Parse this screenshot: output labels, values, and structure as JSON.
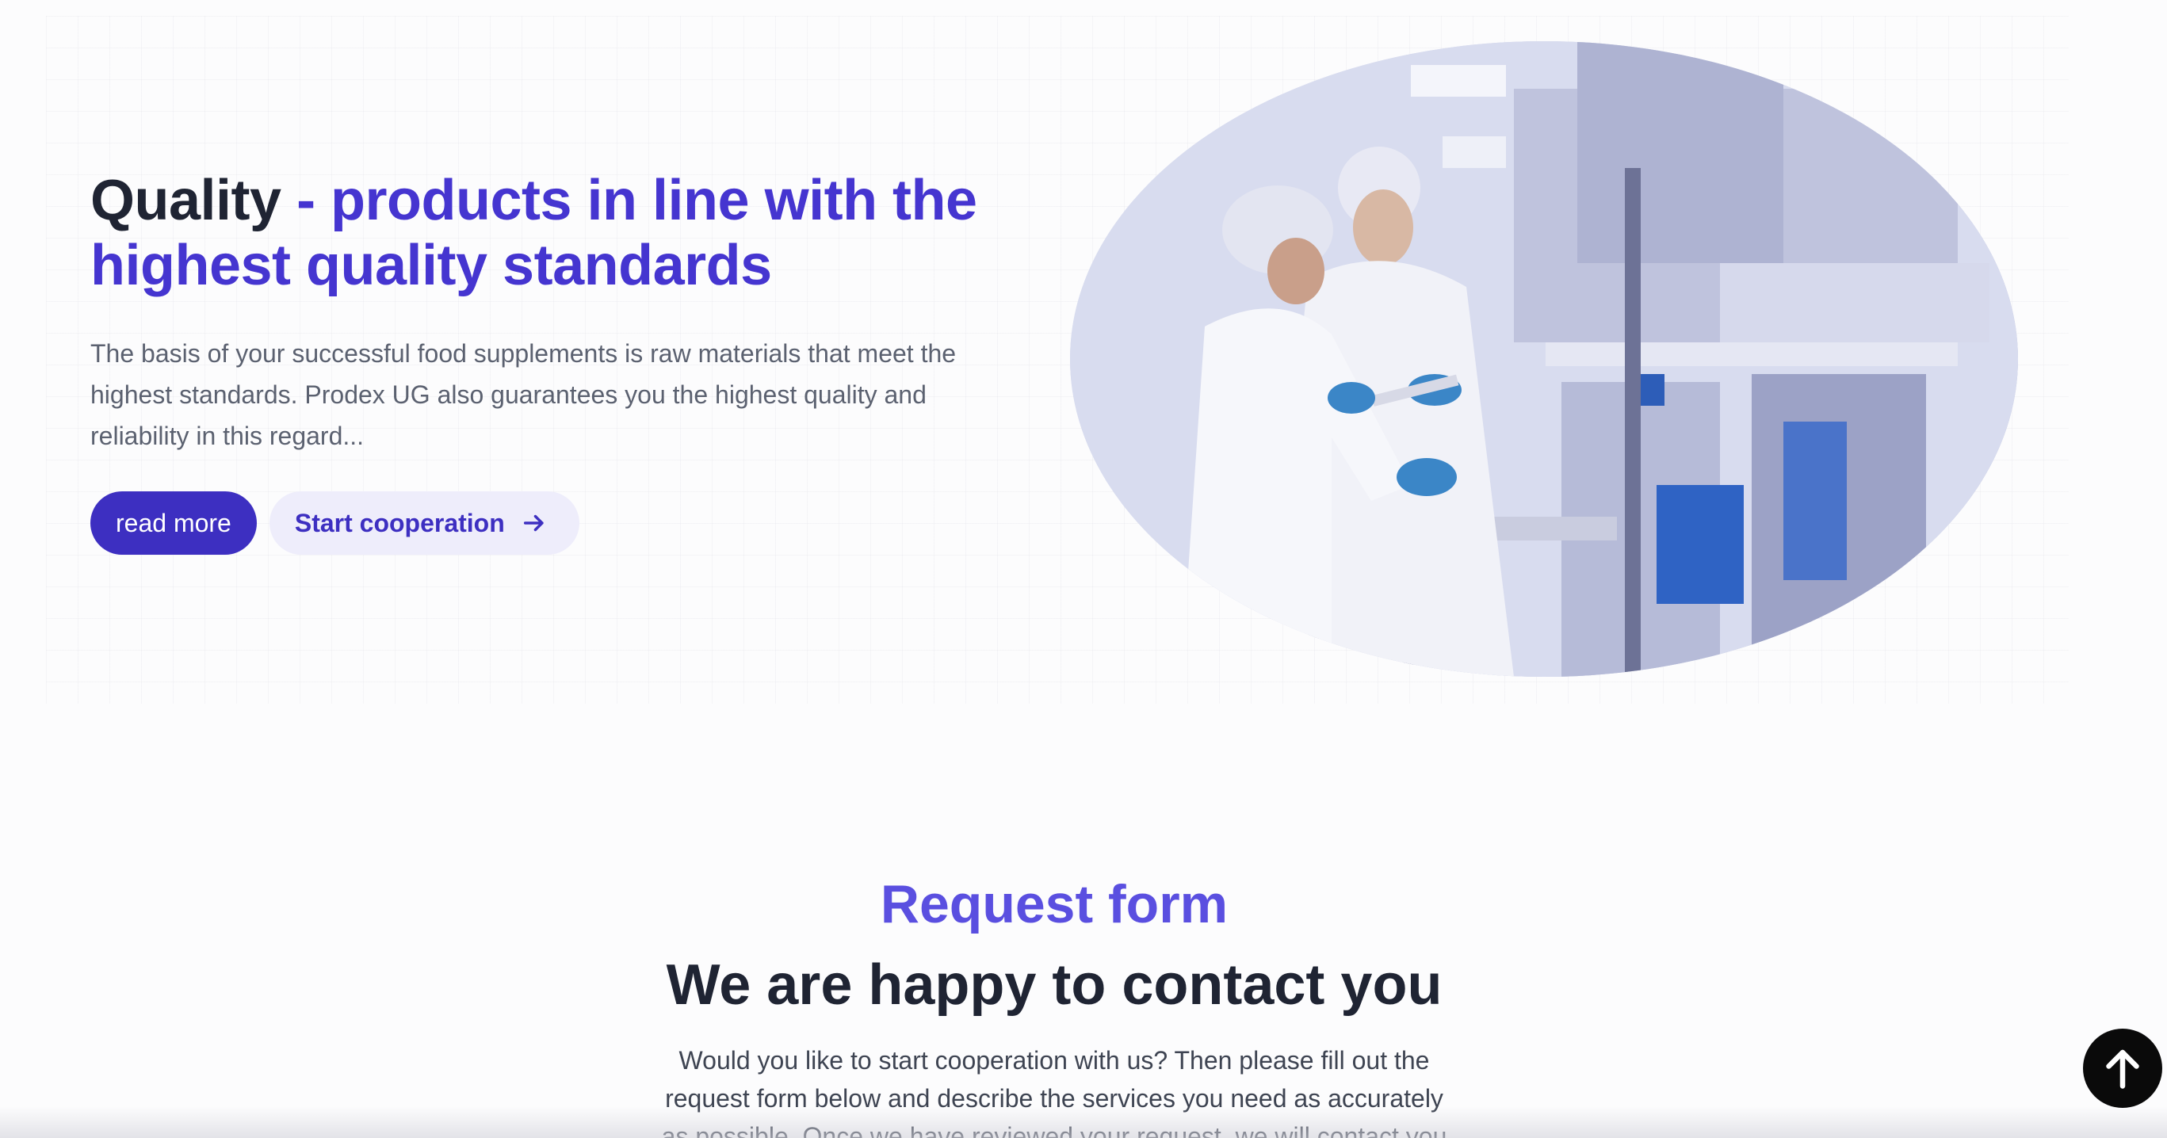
{
  "hero": {
    "title_lead": "Quality",
    "title_accent": " - products in line with the highest quality standards",
    "description": "The basis of your successful food supplements is raw materials that meet the highest standards. Prodex UG also guarantees you the highest quality and reliability in this regard...",
    "read_more_label": "read more",
    "cooperation_label": "Start cooperation",
    "cooperation_icon": "arrow-right-icon"
  },
  "request_form": {
    "eyebrow": "Request form",
    "title": "We are happy to contact you",
    "description": "Would you like to start cooperation with us? Then please fill out the request form below and describe the services you need as accurately as possible. Once we have reviewed your request, we will contact you"
  },
  "scroll_top": {
    "icon": "arrow-up-icon"
  },
  "colors": {
    "accent": "#4535d0",
    "button_primary": "#3d2fc1",
    "button_secondary_bg": "#eeedfb",
    "heading": "#1f2433",
    "eyebrow": "#5a4fe0"
  }
}
